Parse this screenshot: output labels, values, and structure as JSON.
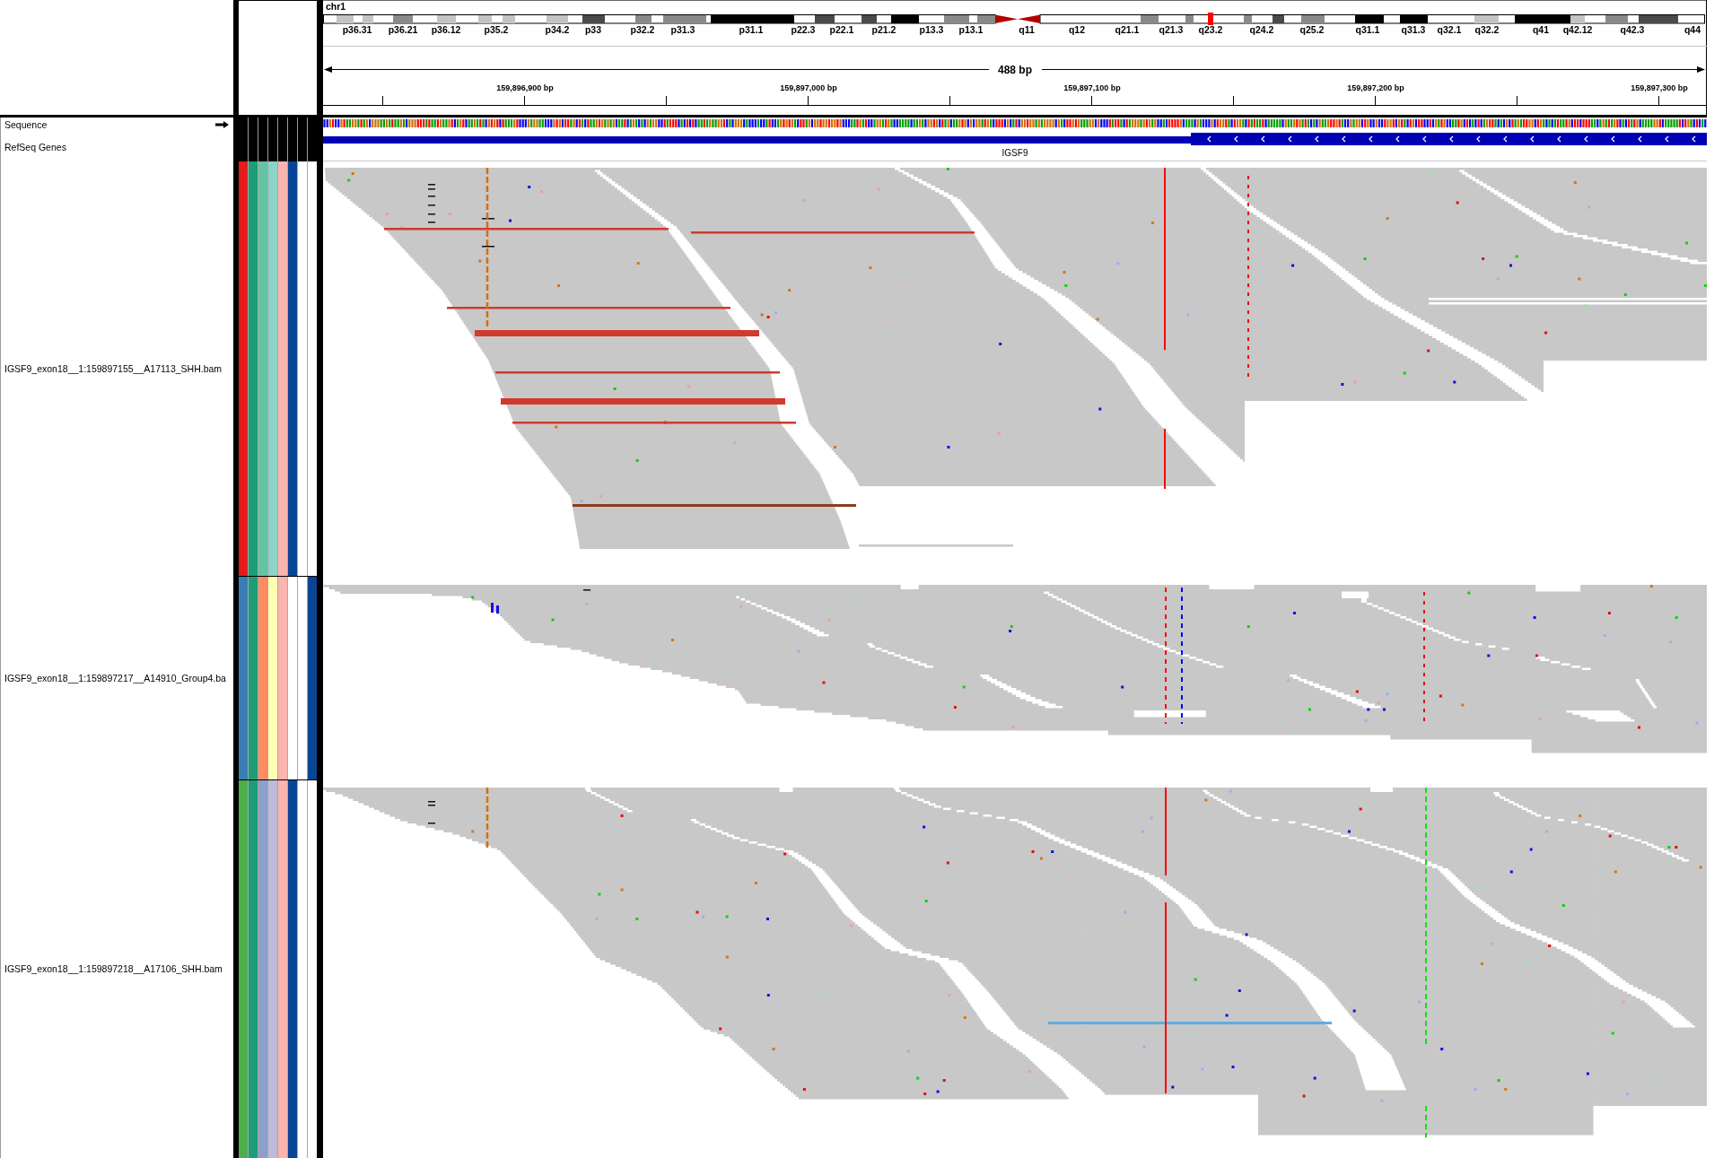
{
  "header": {
    "chromosome": "chr1",
    "cytoband_labels": [
      "p36.31",
      "p36.21",
      "p36.12",
      "p35.2",
      "p34.2",
      "p33",
      "p32.2",
      "p31.3",
      "p31.1",
      "p22.3",
      "p22.1",
      "p21.2",
      "p13.3",
      "p13.1",
      "q11",
      "q12",
      "q21.1",
      "q21.3",
      "q23.2",
      "q24.2",
      "q25.2",
      "q31.1",
      "q31.3",
      "q32.1",
      "q32.2",
      "q41",
      "q42.12",
      "q42.3",
      "q44"
    ],
    "region_length": "488 bp",
    "ruler_labels": [
      "159,896,900 bp",
      "159,897,000 bp",
      "159,897,100 bp",
      "159,897,200 bp",
      "159,897,300 bp"
    ]
  },
  "reference_tracks": [
    {
      "kind": "sequence",
      "name": "Sequence"
    },
    {
      "kind": "gene",
      "name": "RefSeq Genes",
      "feature_label": "IGSF9"
    }
  ],
  "alignment_tracks": [
    {
      "name": "IGSF9_exon18__1:159897155__A17113_SHH.bam",
      "attributes": [
        {
          "color": "#e41a1c"
        },
        {
          "color": "#1b9e77"
        },
        {
          "color": "#66c2a5"
        },
        {
          "color": "#8dd3c7"
        },
        {
          "color": "#fbb4ae"
        },
        {
          "color": "#084594"
        },
        {
          "color": "#ffffff"
        },
        {
          "color": "#ffffff"
        }
      ]
    },
    {
      "name": "IGSF9_exon18__1:159897217__A14910_Group4.ba",
      "attributes": [
        {
          "color": "#377eb8"
        },
        {
          "color": "#1b9e77"
        },
        {
          "color": "#fc8d62"
        },
        {
          "color": "#ffffb3"
        },
        {
          "color": "#fbb4ae"
        },
        {
          "color": "#ffffff"
        },
        {
          "color": "#ffffff"
        },
        {
          "color": "#084594"
        }
      ]
    },
    {
      "name": "IGSF9_exon18__1:159897218__A17106_SHH.bam",
      "attributes": [
        {
          "color": "#4daf4a"
        },
        {
          "color": "#1b9e77"
        },
        {
          "color": "#8da0cb"
        },
        {
          "color": "#bebada"
        },
        {
          "color": "#fbb4ae"
        },
        {
          "color": "#084594"
        },
        {
          "color": "#ffffff"
        },
        {
          "color": "#ffffff"
        }
      ]
    }
  ]
}
